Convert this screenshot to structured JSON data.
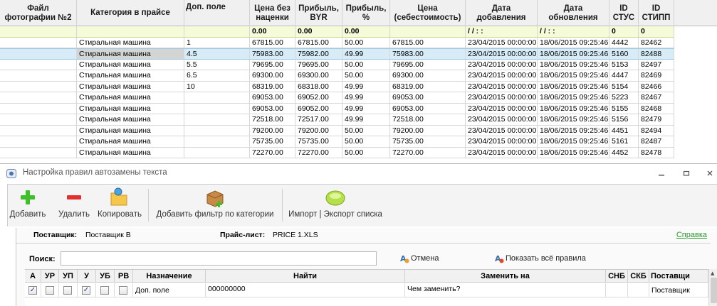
{
  "grid": {
    "columns": [
      {
        "label": "Файл\nфотографии №2"
      },
      {
        "label": "Категория в прайсе"
      },
      {
        "label": "Доп. поле"
      },
      {
        "label": "Цена без\nнаценки"
      },
      {
        "label": "Прибыль,\nBYR"
      },
      {
        "label": "Прибыль,\n%"
      },
      {
        "label": "Цена\n(себестоимость)"
      },
      {
        "label": "Дата\nдобавления"
      },
      {
        "label": "Дата\nобновления"
      },
      {
        "label": "ID\nСТУС"
      },
      {
        "label": "ID\nСТИПП"
      }
    ],
    "filter_row": [
      "",
      "",
      "",
      "0.00",
      "0.00",
      "0.00",
      "",
      "/ /    : :",
      "/ /    : :",
      "0",
      "0"
    ],
    "rows": [
      [
        "",
        "Стиральная машина",
        "1",
        "67815.00",
        "67815.00",
        "50.00",
        "67815.00",
        "23/04/2015 00:00:00",
        "18/06/2015 09:25:46",
        "4442",
        "82462"
      ],
      [
        "",
        "Стиральная машина",
        "4.5",
        "75983.00",
        "75982.00",
        "49.99",
        "75983.00",
        "23/04/2015 00:00:00",
        "18/06/2015 09:25:46",
        "5160",
        "82488"
      ],
      [
        "",
        "Стиральная машина",
        "5.5",
        "79695.00",
        "79695.00",
        "50.00",
        "79695.00",
        "23/04/2015 00:00:00",
        "18/06/2015 09:25:46",
        "5153",
        "82497"
      ],
      [
        "",
        "Стиральная машина",
        "6.5",
        "69300.00",
        "69300.00",
        "50.00",
        "69300.00",
        "23/04/2015 00:00:00",
        "18/06/2015 09:25:46",
        "4447",
        "82469"
      ],
      [
        "",
        "Стиральная машина",
        "10",
        "68319.00",
        "68318.00",
        "49.99",
        "68319.00",
        "23/04/2015 00:00:00",
        "18/06/2015 09:25:46",
        "5154",
        "82466"
      ],
      [
        "",
        "Стиральная машина",
        "",
        "69053.00",
        "69052.00",
        "49.99",
        "69053.00",
        "23/04/2015 00:00:00",
        "18/06/2015 09:25:46",
        "5223",
        "82467"
      ],
      [
        "",
        "Стиральная машина",
        "",
        "69053.00",
        "69052.00",
        "49.99",
        "69053.00",
        "23/04/2015 00:00:00",
        "18/06/2015 09:25:46",
        "5155",
        "82468"
      ],
      [
        "",
        "Стиральная машина",
        "",
        "72518.00",
        "72517.00",
        "49.99",
        "72518.00",
        "23/04/2015 00:00:00",
        "18/06/2015 09:25:46",
        "5156",
        "82479"
      ],
      [
        "",
        "Стиральная машина",
        "",
        "79200.00",
        "79200.00",
        "50.00",
        "79200.00",
        "23/04/2015 00:00:00",
        "18/06/2015 09:25:46",
        "4451",
        "82494"
      ],
      [
        "",
        "Стиральная машина",
        "",
        "75735.00",
        "75735.00",
        "50.00",
        "75735.00",
        "23/04/2015 00:00:00",
        "18/06/2015 09:25:46",
        "5161",
        "82487"
      ],
      [
        "",
        "Стиральная машина",
        "",
        "72270.00",
        "72270.00",
        "50.00",
        "72270.00",
        "23/04/2015 00:00:00",
        "18/06/2015 09:25:46",
        "4452",
        "82478"
      ]
    ],
    "selected_row": 1
  },
  "dialog": {
    "title": "Настройка правил автозамены текста",
    "toolbar": {
      "add": "Добавить",
      "delete": "Удалить",
      "copy": "Копировать",
      "add_filter": "Добавить фильтр по категории",
      "import_export": "Импорт | Экспорт списка"
    },
    "supplier_label": "Поставщик:",
    "supplier_value": "Поставщик В",
    "pricelist_label": "Прайс-лист:",
    "pricelist_value": "PRICE 1.XLS",
    "help": "Справка",
    "search_label": "Поиск:",
    "search_value": "",
    "cancel": "Отмена",
    "show_all": "Показать всё правила",
    "rules": {
      "headers": [
        "А",
        "УР",
        "УП",
        "У",
        "УБ",
        "РВ",
        "Назначение",
        "Найти",
        "Заменить на",
        "СНБ",
        "СКБ",
        "Поставщи"
      ],
      "row": {
        "checks": [
          true,
          false,
          false,
          true,
          false,
          false
        ],
        "target": "Доп. поле",
        "find": "000000000",
        "replace": "Чем заменить?",
        "supplier": "Поставщик"
      }
    }
  },
  "colors": {
    "selected_row": "#d8ecf8",
    "filter_row": "#f5fbd8",
    "help_link": "#2a9a2a"
  }
}
